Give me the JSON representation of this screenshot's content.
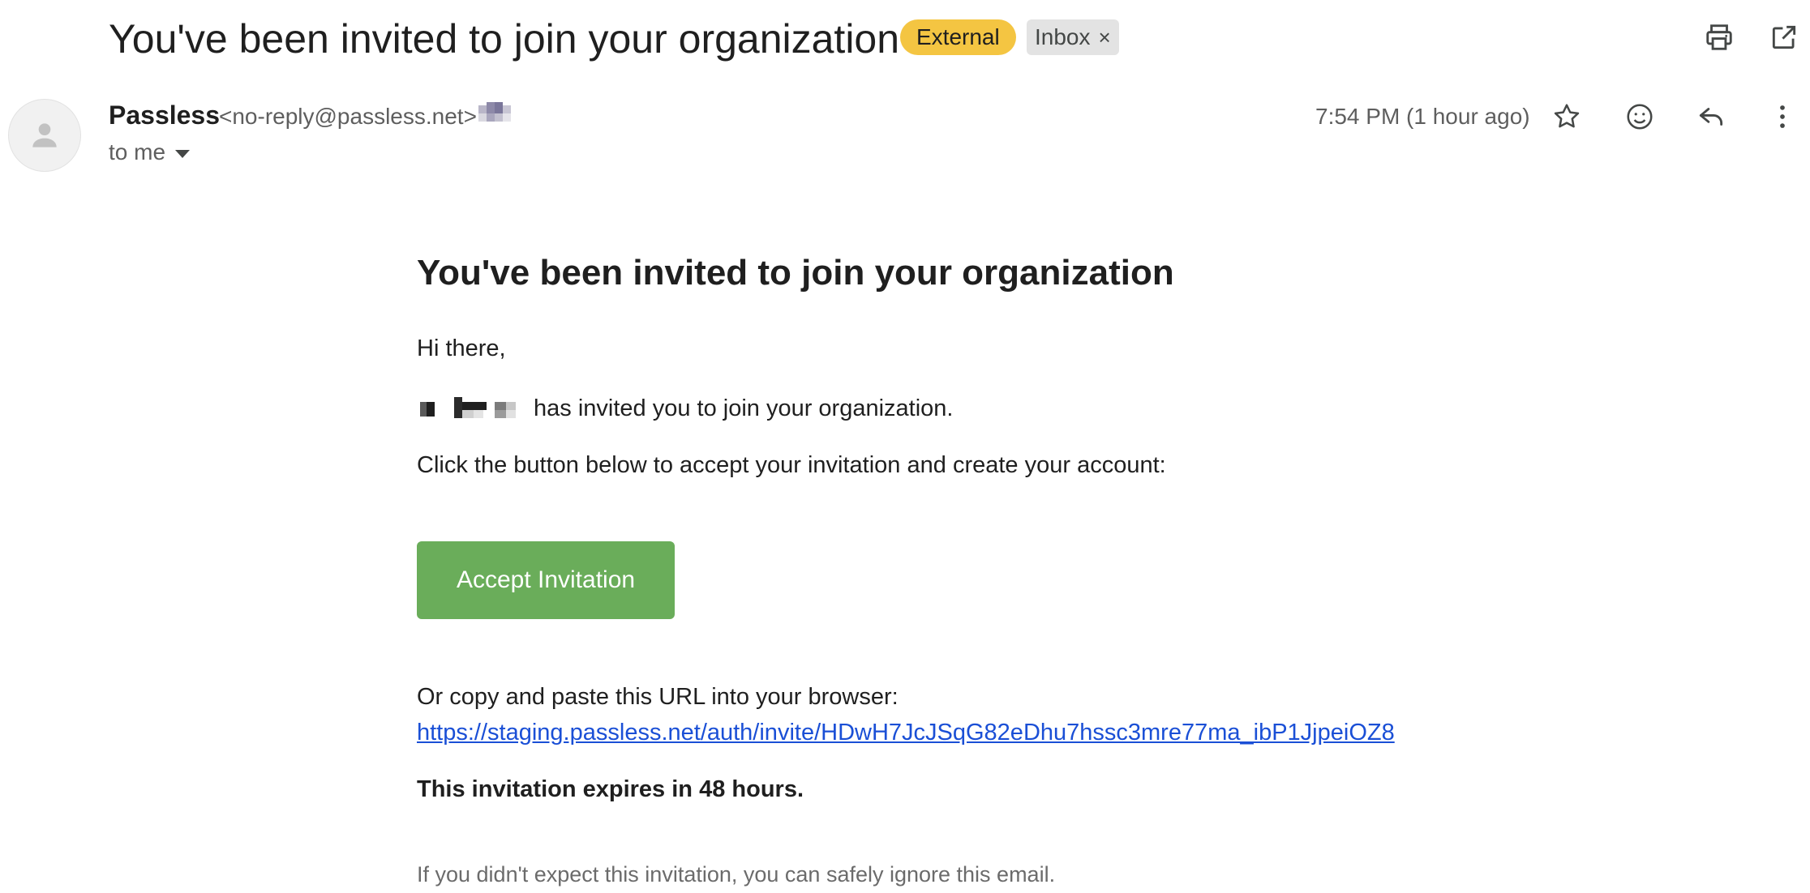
{
  "email": {
    "subject": "You've been invited to join your organization",
    "labels": {
      "external": "External",
      "inbox": "Inbox",
      "remove": "×"
    },
    "sender": {
      "name": "Passless",
      "email": "<no-reply@passless.net>",
      "to": "to me"
    },
    "timestamp": "7:54 PM (1 hour ago)",
    "icons": {
      "print": "print-icon",
      "open_new_window": "open-in-new-icon",
      "star": "star-icon",
      "emoji": "emoji-icon",
      "reply": "reply-icon",
      "more": "more-vert-icon",
      "avatar": "person-icon"
    },
    "body": {
      "heading": "You've been invited to join your organization",
      "greeting": "Hi there,",
      "invited_text": "has invited you to join your organization.",
      "instruction": "Click the button below to accept your invitation and create your account:",
      "button_label": "Accept Invitation",
      "copy_text": "Or copy and paste this URL into your browser:",
      "url": "https://staging.passless.net/auth/invite/HDwH7JcJSqG82eDhu7hssc3mre77ma_ibP1JjpeiOZ8",
      "expires": "This invitation expires in 48 hours.",
      "ignore": "If you didn't expect this invitation, you can safely ignore this email."
    }
  },
  "colors": {
    "external_badge": "#f4c542",
    "inbox_badge": "#e3e3e3",
    "accept_button": "#6aad5a",
    "link": "#1a4fd6"
  }
}
